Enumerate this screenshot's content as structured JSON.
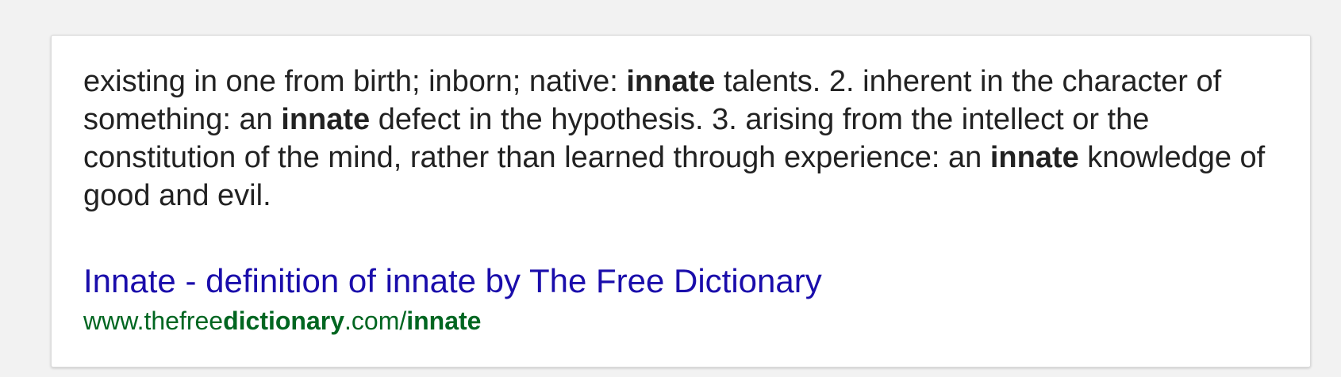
{
  "snippet": {
    "segments": [
      {
        "text": "existing in one from birth; inborn; native: ",
        "bold": false
      },
      {
        "text": "innate",
        "bold": true
      },
      {
        "text": " talents. 2. inherent in the character of something: an ",
        "bold": false
      },
      {
        "text": "innate",
        "bold": true
      },
      {
        "text": " defect in the hypothesis. 3. arising from the intellect or the constitution of the mind, rather than learned through experience: an ",
        "bold": false
      },
      {
        "text": "innate",
        "bold": true
      },
      {
        "text": " knowledge of good and evil.",
        "bold": false
      }
    ]
  },
  "result": {
    "title": "Innate - definition of innate by The Free Dictionary",
    "url_segments": [
      {
        "text": "www.thefree",
        "bold": false
      },
      {
        "text": "dictionary",
        "bold": true
      },
      {
        "text": ".com/",
        "bold": false
      },
      {
        "text": "innate",
        "bold": true
      }
    ]
  },
  "colors": {
    "title_link": "#1a0dab",
    "url": "#006621",
    "snippet_text": "#222222"
  }
}
